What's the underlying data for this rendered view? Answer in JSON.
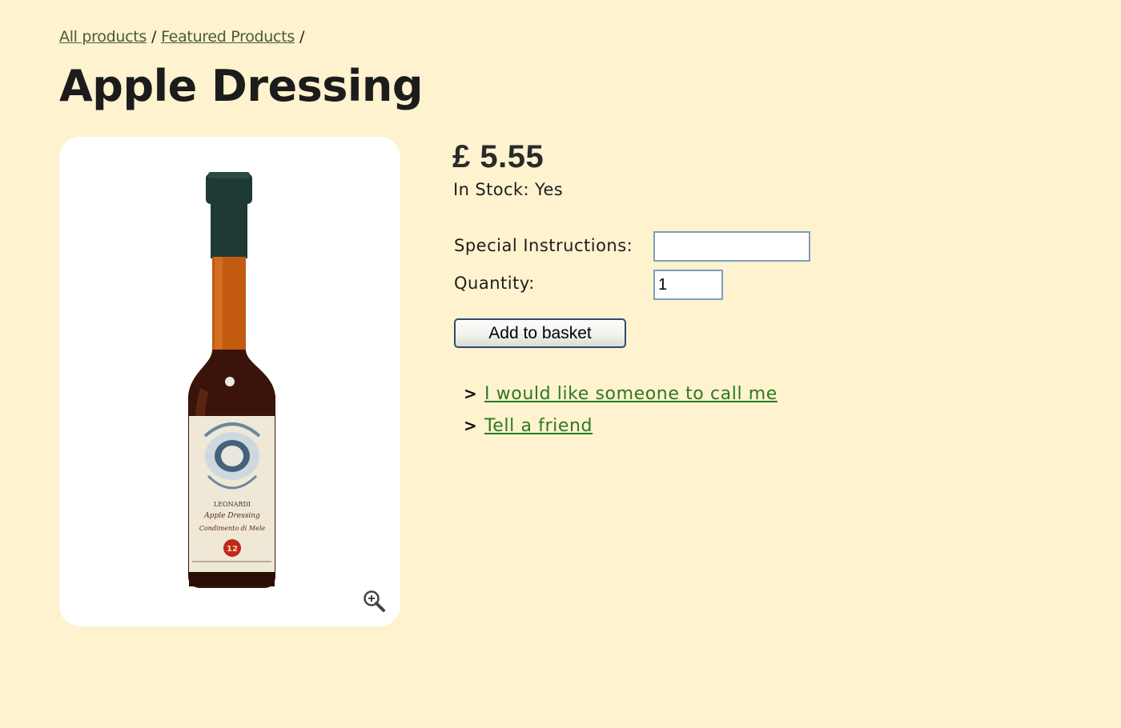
{
  "breadcrumb": {
    "items": [
      "All products",
      "Featured Products"
    ],
    "separator": "/"
  },
  "product": {
    "title": "Apple Dressing",
    "price": "£ 5.55",
    "stock": "In Stock: Yes",
    "image_icon": "zoom-in-icon",
    "label_text": {
      "brand": "LEONARDI",
      "name": "Apple Dressing",
      "sub": "Condimento di Mele",
      "age": "12"
    }
  },
  "form": {
    "special_instructions_label": "Special Instructions:",
    "special_instructions_value": "",
    "quantity_label": "Quantity:",
    "quantity_value": "1",
    "add_button_label": "Add to basket"
  },
  "links": [
    {
      "arrow": ">",
      "label": "I would like someone to call me"
    },
    {
      "arrow": ">",
      "label": "Tell a friend"
    }
  ],
  "colors": {
    "background": "#fef2cf",
    "link": "#2b7a1e",
    "card": "#ffffff"
  }
}
